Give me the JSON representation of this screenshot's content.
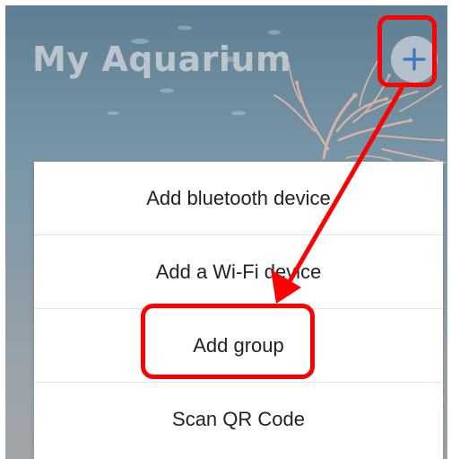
{
  "header": {
    "title": "My Aquarium",
    "add_button_icon": "plus-icon"
  },
  "menu": {
    "items": [
      {
        "label": "Add bluetooth device"
      },
      {
        "label": "Add a Wi-Fi device"
      },
      {
        "label": "Add group"
      },
      {
        "label": "Scan QR Code"
      }
    ]
  },
  "annotation": {
    "color": "#ff0000",
    "highlighted_item": "Add group"
  },
  "colors": {
    "background_top": "#5d7f93",
    "background_bottom": "#a1a5a9",
    "coral": "#e8b8a8",
    "menu_bg": "#ffffff",
    "menu_text": "#222222",
    "add_button_bg": "#bec8d2",
    "add_button_icon": "#3a78c4"
  }
}
